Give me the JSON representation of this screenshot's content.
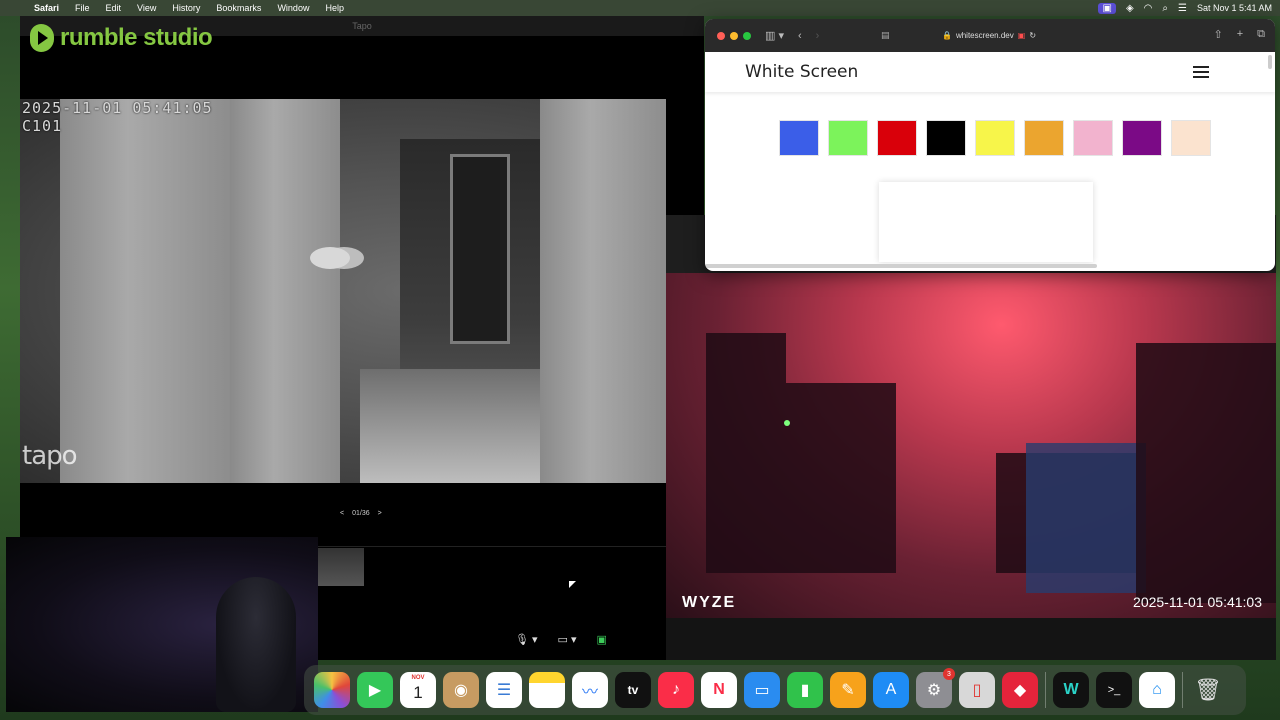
{
  "menubar": {
    "app_name": "Safari",
    "items": [
      "File",
      "Edit",
      "View",
      "History",
      "Bookmarks",
      "Window",
      "Help"
    ],
    "clock": "Sat Nov 1  5:41 AM"
  },
  "tapo": {
    "window_title": "Tapo",
    "osd_timestamp": "2025-11-01 05:41:05",
    "osd_channel": "C101",
    "logo": "tapo",
    "pager_prev": "<",
    "pager_text": "01/36",
    "pager_next": ">"
  },
  "rumble": {
    "logo_text": "rumble studio"
  },
  "wyze": {
    "logo": "WYZE",
    "timestamp": "2025-11-01 05:41:03"
  },
  "safari": {
    "url": "whitescreen.dev",
    "site_title": "White Screen",
    "swatch_colors": [
      "#3b5ee8",
      "#7cf35b",
      "#d9000a",
      "#000000",
      "#f7f54a",
      "#eba52f",
      "#f2b3ce",
      "#7b0a86",
      "#fbe3cf"
    ]
  },
  "dock": {
    "calendar_month": "NOV",
    "calendar_day": "1",
    "settings_badge": "3",
    "tv_label": "tv"
  }
}
